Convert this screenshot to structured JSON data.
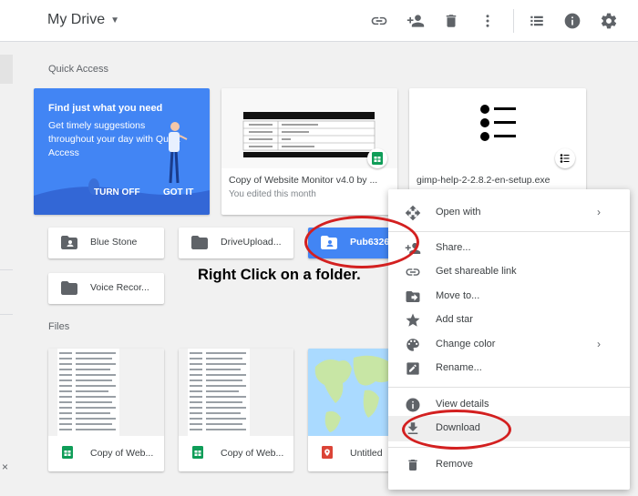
{
  "header": {
    "title": "My Drive",
    "icons": [
      "link-icon",
      "share-icon",
      "trash-icon",
      "more-vert-icon",
      "list-view-icon",
      "info-icon",
      "settings-icon"
    ]
  },
  "quick_access": {
    "label": "Quick Access",
    "promo": {
      "title": "Find just what you need",
      "body": "Get timely suggestions throughout your day with Quick Access",
      "turn_off": "TURN OFF",
      "got_it": "GOT IT"
    },
    "cards": [
      {
        "name": "Copy of Website Monitor v4.0 by ...",
        "sub": "You edited this month"
      },
      {
        "name": "gimp-help-2-2.8.2-en-setup.exe",
        "sub": ""
      }
    ]
  },
  "folders": [
    {
      "name": "Blue Stone"
    },
    {
      "name": "DriveUpload..."
    },
    {
      "name": "Pub6326"
    },
    {
      "name": "Voice Recor..."
    }
  ],
  "annotation": "Right Click on a folder.",
  "files": {
    "label": "Files",
    "items": [
      {
        "name": "Copy of Web..."
      },
      {
        "name": "Copy of Web..."
      },
      {
        "name": "Untitled"
      }
    ]
  },
  "context_menu": {
    "items": [
      {
        "label": "Open with",
        "icon": "open-with-icon",
        "submenu": true
      },
      {
        "label": "Share...",
        "icon": "person-add-icon"
      },
      {
        "label": "Get shareable link",
        "icon": "link-icon"
      },
      {
        "label": "Move to...",
        "icon": "move-to-icon"
      },
      {
        "label": "Add star",
        "icon": "star-icon"
      },
      {
        "label": "Change color",
        "icon": "palette-icon",
        "submenu": true
      },
      {
        "label": "Rename...",
        "icon": "rename-icon"
      },
      {
        "label": "View details",
        "icon": "info-icon"
      },
      {
        "label": "Download",
        "icon": "download-icon",
        "highlighted": true
      },
      {
        "label": "Remove",
        "icon": "trash-icon"
      }
    ],
    "submenu_arrow": "›"
  },
  "colors": {
    "accent": "#4285f4",
    "annotation_circle": "#d32020",
    "sheets_green": "#0f9d58",
    "maps_red": "#db4437"
  },
  "close_glyph": "×"
}
